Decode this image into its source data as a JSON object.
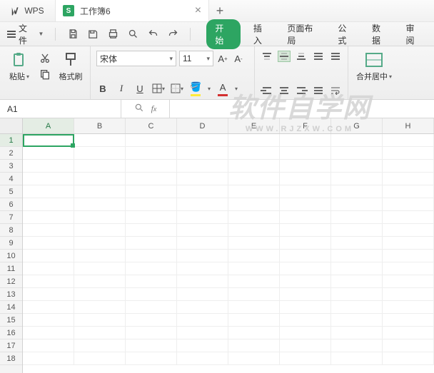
{
  "titlebar": {
    "app": "WPS",
    "doc": "工作簿6"
  },
  "menu": {
    "file": "文件"
  },
  "tabs": {
    "start": "开始",
    "insert": "插入",
    "page": "页面布局",
    "formula": "公式",
    "data": "数据",
    "review": "审阅"
  },
  "ribbon": {
    "paste": "粘贴",
    "format_painter": "格式刷",
    "font_name": "宋体",
    "font_size": "11",
    "merge": "合并居中"
  },
  "namebox": "A1",
  "columns": [
    "A",
    "B",
    "C",
    "D",
    "E",
    "F",
    "G",
    "H"
  ],
  "rows": [
    "1",
    "2",
    "3",
    "4",
    "5",
    "6",
    "7",
    "8",
    "9",
    "10",
    "11",
    "12",
    "13",
    "14",
    "15",
    "16",
    "17",
    "18"
  ],
  "watermark": {
    "main": "软件自学网",
    "sub": "WWW.RJZXW.COM"
  }
}
